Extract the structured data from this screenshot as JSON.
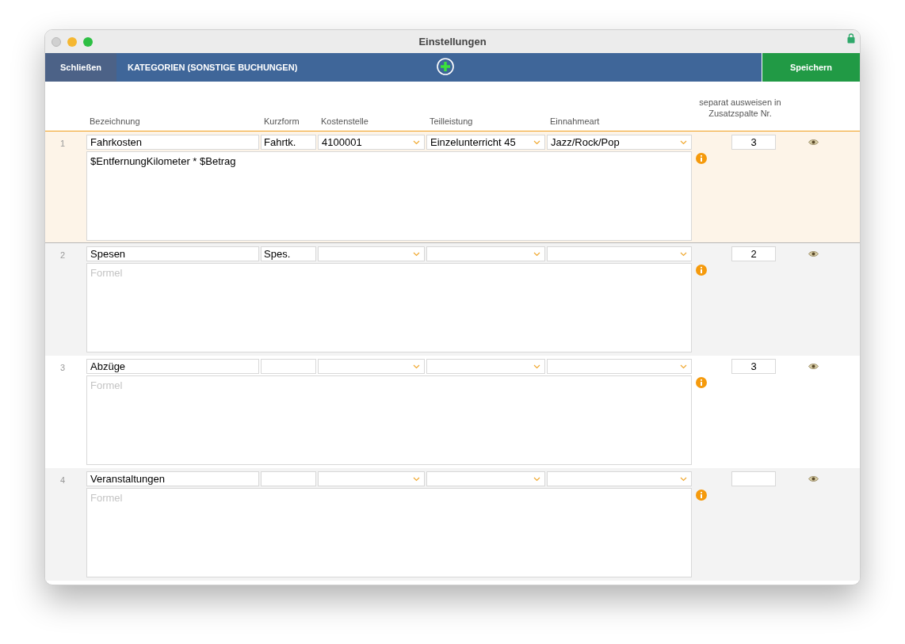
{
  "window": {
    "title": "Einstellungen"
  },
  "toolbar": {
    "close_button": "Schließen",
    "section_title": "KATEGORIEN (SONSTIGE BUCHUNGEN)",
    "save_button": "Speichern"
  },
  "columns": [
    "Bezeichnung",
    "Kurzform",
    "Kostenstelle",
    "Teilleistung",
    "Einnahmeart",
    "separat ausweisen in Zusatzspalte Nr."
  ],
  "rows": [
    {
      "number": "1",
      "selected": true,
      "name": "Fahrkosten",
      "short": "Fahrtk.",
      "cost_center": "4100001",
      "service": "Einzelunterricht 45",
      "income_type": "Jazz/Rock/Pop",
      "formula": "$EntfernungKilometer * $Betrag",
      "column_no": "3"
    },
    {
      "number": "2",
      "selected": false,
      "name": "Spesen",
      "short": "Spes.",
      "formula_placeholder": "Formel",
      "column_no": "2"
    },
    {
      "number": "3",
      "selected": false,
      "name": "Abzüge",
      "formula_placeholder": "Formel",
      "column_no": "3"
    },
    {
      "number": "4",
      "selected": false,
      "name": "Veranstaltungen",
      "formula_placeholder": "Formel"
    }
  ]
}
